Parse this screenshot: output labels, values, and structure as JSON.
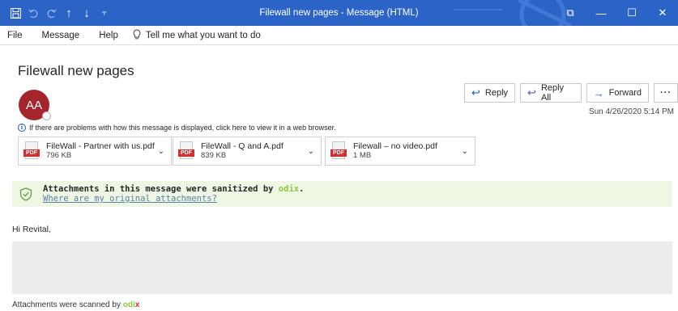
{
  "window": {
    "title": "Filewall new pages  -  Message (HTML)",
    "controls": {
      "restore": "⧉",
      "minimize": "—",
      "maximize": "☐",
      "close": "✕"
    }
  },
  "qat": {
    "save": "save-icon",
    "undo": "undo-icon",
    "redo": "redo-icon",
    "up": "↑",
    "down": "↓",
    "customize": "⫧"
  },
  "menu": {
    "items": [
      "File",
      "Message",
      "Help"
    ],
    "tell_me": "Tell me what you want to do"
  },
  "message": {
    "subject": "Filewall new pages",
    "sender_initials": "AA",
    "date": "Sun 4/26/2020 5:14 PM",
    "info_bar": "If there are problems with how this message is displayed, click here to view it in a web browser.",
    "greeting": "Hi Revital,"
  },
  "actions": {
    "reply": "Reply",
    "reply_all": "Reply All",
    "forward": "Forward",
    "more": "···"
  },
  "attachments": [
    {
      "name": "FileWall - Partner with us.pdf",
      "size": "796 KB",
      "type": "PDF"
    },
    {
      "name": "FileWall - Q and A.pdf",
      "size": "839 KB",
      "type": "PDF"
    },
    {
      "name": "Filewall – no video.pdf",
      "size": "1 MB",
      "type": "PDF"
    }
  ],
  "banner": {
    "text_before": "Attachments in this message were sanitized by ",
    "brand": "odix",
    "text_after": ".",
    "link": "Where are my original attachments?"
  },
  "footer": {
    "text": "Attachments were scanned by ",
    "brand": "odi",
    "brand_x": "x"
  },
  "colors": {
    "titlebar": "#2b64c6",
    "avatar": "#a4262c",
    "accent": "#1f5bb8",
    "odix_green": "#8dc63f",
    "pdf_red": "#d32f2f",
    "banner_bg": "#eff7e4"
  }
}
